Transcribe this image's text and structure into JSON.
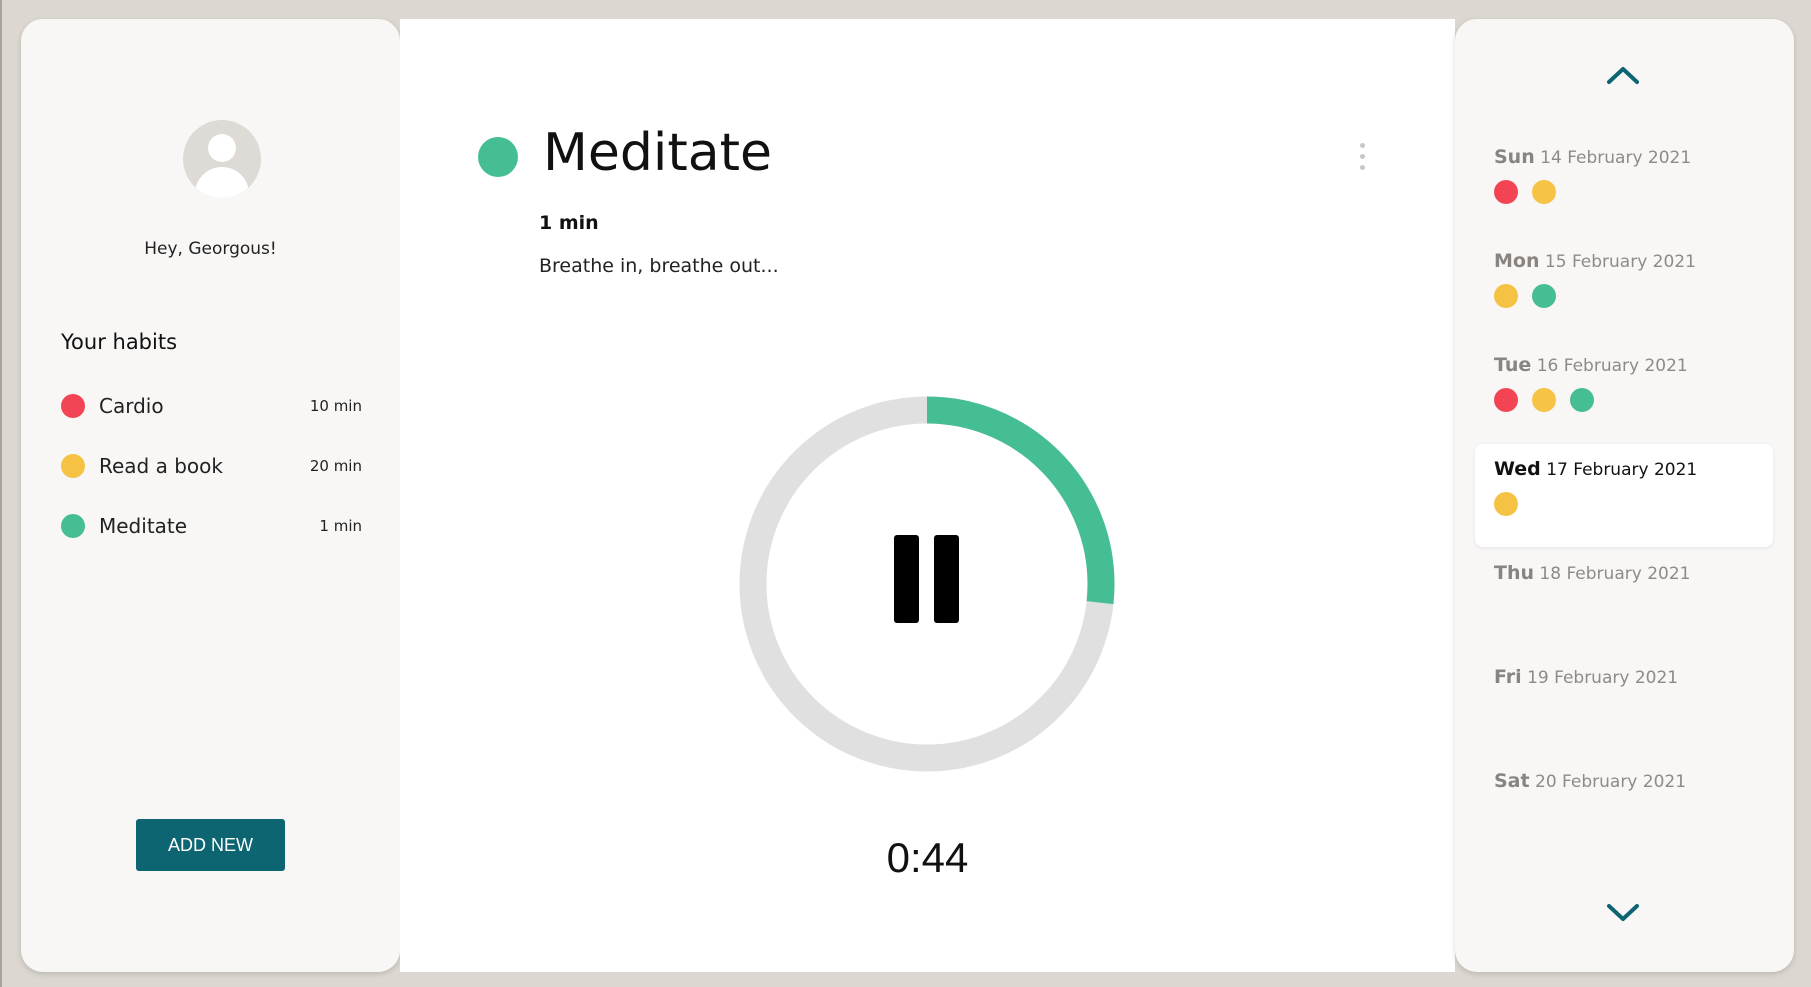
{
  "colors": {
    "red": "#f24455",
    "yellow": "#f5c244",
    "green": "#46be93",
    "accent": "#0c6570",
    "ring_track": "#e0e0e0"
  },
  "sidebar": {
    "greeting": "Hey, Georgous!",
    "habits_title": "Your habits",
    "habits": [
      {
        "name": "Cardio",
        "duration": "10 min",
        "color": "red"
      },
      {
        "name": "Read a book",
        "duration": "20 min",
        "color": "yellow"
      },
      {
        "name": "Meditate",
        "duration": "1 min",
        "color": "green"
      }
    ],
    "add_label": "ADD NEW"
  },
  "main": {
    "title": "Meditate",
    "color": "green",
    "duration": "1 min",
    "description": "Breathe in, breathe out...",
    "progress": 0.267,
    "time": "0:44"
  },
  "calendar": {
    "days": [
      {
        "dow": "Sun",
        "date": "14 February 2021",
        "dots": [
          "red",
          "yellow"
        ],
        "active": false
      },
      {
        "dow": "Mon",
        "date": "15 February 2021",
        "dots": [
          "yellow",
          "green"
        ],
        "active": false
      },
      {
        "dow": "Tue",
        "date": "16 February 2021",
        "dots": [
          "red",
          "yellow",
          "green"
        ],
        "active": false
      },
      {
        "dow": "Wed",
        "date": "17 February 2021",
        "dots": [
          "yellow"
        ],
        "active": true
      },
      {
        "dow": "Thu",
        "date": "18 February 2021",
        "dots": [],
        "active": false
      },
      {
        "dow": "Fri",
        "date": "19 February 2021",
        "dots": [],
        "active": false
      },
      {
        "dow": "Sat",
        "date": "20 February 2021",
        "dots": [],
        "active": false
      }
    ]
  }
}
